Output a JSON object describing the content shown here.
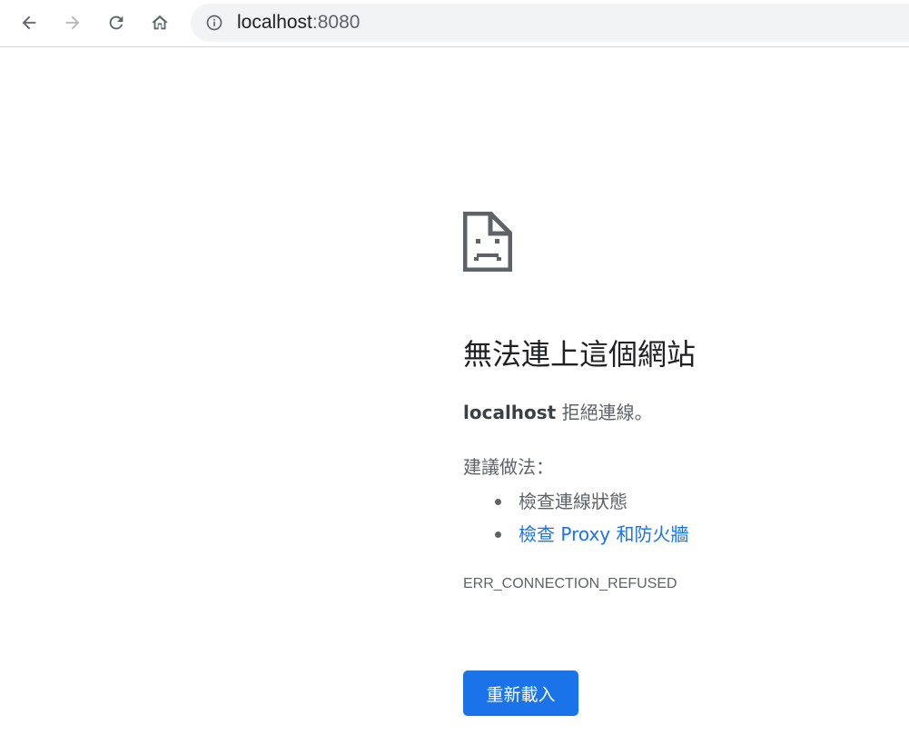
{
  "browser": {
    "url_host": "localhost",
    "url_port": ":8080",
    "icons": {
      "back": "arrow-left-icon",
      "forward": "arrow-right-icon",
      "reload": "reload-icon",
      "home": "home-icon",
      "site_info": "info-circle-icon"
    }
  },
  "error_page": {
    "icon": "sad-document-icon",
    "title": "無法連上這個網站",
    "detail_host": "localhost",
    "detail_message": " 拒絕連線。",
    "suggestions_title": "建議做法：",
    "suggestions": [
      {
        "label": "檢查連線狀態",
        "is_link": false
      },
      {
        "label": "檢查 Proxy 和防火牆",
        "is_link": true
      }
    ],
    "error_code": "ERR_CONNECTION_REFUSED",
    "reload_label": "重新載入"
  },
  "colors": {
    "accent": "#1a73e8",
    "text_primary": "#202124",
    "text_secondary": "#5f6368",
    "omnibox_bg": "#f1f3f4"
  }
}
